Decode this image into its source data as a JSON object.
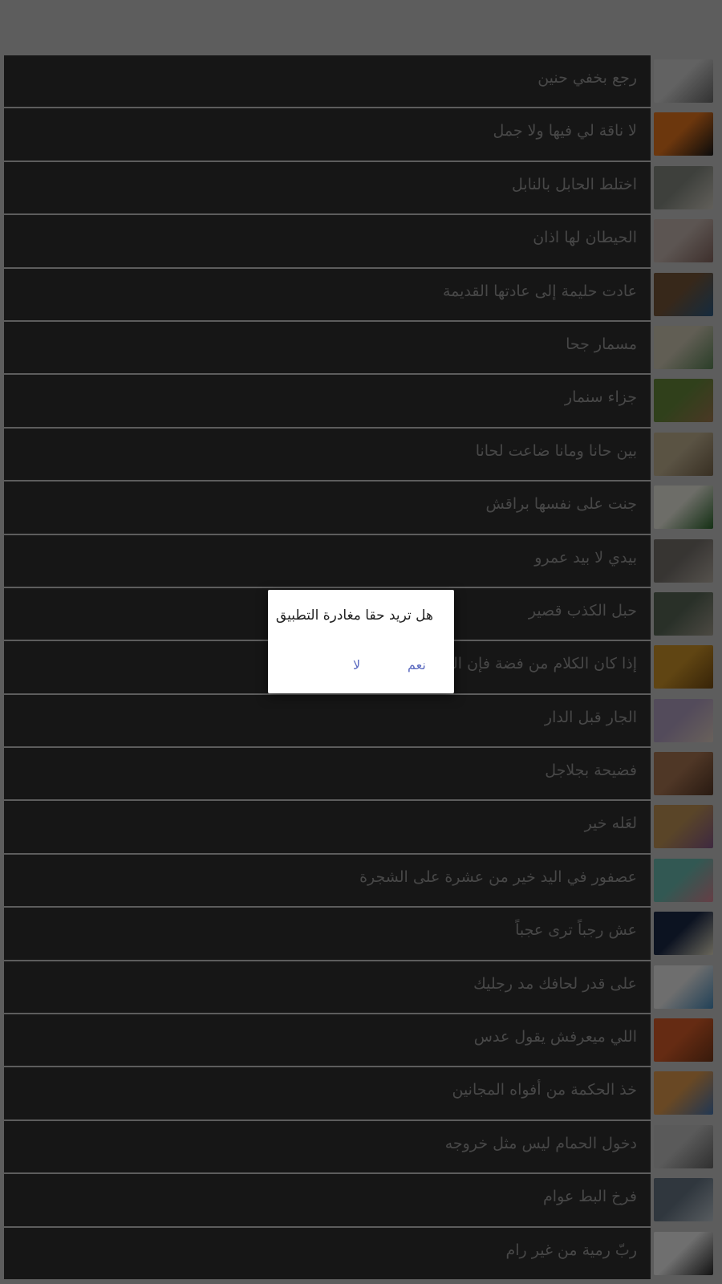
{
  "items": [
    {
      "label": "رجع بخفي حنين",
      "thumb": [
        "#d9d9d9",
        "#6f6f6f"
      ]
    },
    {
      "label": "لا ناقة لي فيها ولا جمل",
      "thumb": [
        "#f07a1e",
        "#1a1a1a"
      ]
    },
    {
      "label": "اختلط الحابل بالنابل",
      "thumb": [
        "#8a8f86",
        "#d8d3c8"
      ]
    },
    {
      "label": "الحيطان لها اذان",
      "thumb": [
        "#cdbdb6",
        "#8a6a63"
      ]
    },
    {
      "label": "عادت حليمة إلى عادتها القديمة",
      "thumb": [
        "#7b5a3b",
        "#2f5f8a"
      ]
    },
    {
      "label": "مسمار جحا",
      "thumb": [
        "#d7d0bb",
        "#5f8a5a"
      ]
    },
    {
      "label": "جزاء سنمار",
      "thumb": [
        "#6b8f3d",
        "#a67c52"
      ]
    },
    {
      "label": "بين حانا ومانا ضاعت لحانا",
      "thumb": [
        "#c8b896",
        "#7d6a4f"
      ]
    },
    {
      "label": "جنت على نفسها  براقش",
      "thumb": [
        "#f2f2e6",
        "#2e6b2e"
      ]
    },
    {
      "label": "بيدي لا بيد عمرو",
      "thumb": [
        "#7a7570",
        "#bdb5aa"
      ]
    },
    {
      "label": "حبل الكذب قصير",
      "thumb": [
        "#5b6b5a",
        "#a9a394"
      ]
    },
    {
      "label": "إذا كان الكلام من فضة فإن السكوت من ذهب",
      "thumb": [
        "#d69a2a",
        "#7a4f12"
      ]
    },
    {
      "label": "الجار قبل الدار",
      "thumb": [
        "#b9a6c9",
        "#e8d7cb"
      ]
    },
    {
      "label": "فضيحة بجلاجل",
      "thumb": [
        "#b07a55",
        "#5a3a28"
      ]
    },
    {
      "label": "لعَله خير",
      "thumb": [
        "#c79a5a",
        "#8a5b8f"
      ]
    },
    {
      "label": "عصفور في اليد خير من عشرة على الشجرة",
      "thumb": [
        "#6fc4b8",
        "#e28a9a"
      ]
    },
    {
      "label": "عش رجباً ترى عجباً",
      "thumb": [
        "#1c2a4a",
        "#e8e2c8"
      ]
    },
    {
      "label": "على قدر لحافك مد رجليك",
      "thumb": [
        "#f4f4f4",
        "#4a90c2"
      ]
    },
    {
      "label": "اللي ميعرفش يقول عدس",
      "thumb": [
        "#e0602a",
        "#7a3a1a"
      ]
    },
    {
      "label": "خذ الحكمة من أفواه المجانين",
      "thumb": [
        "#e8a050",
        "#4a7ab8"
      ]
    },
    {
      "label": "دخول الحمام ليس مثل خروجه",
      "thumb": [
        "#c8c8c8",
        "#6a6a6a"
      ]
    },
    {
      "label": "فرخ البط عوام",
      "thumb": [
        "#6a7a8a",
        "#c2ccd4"
      ]
    },
    {
      "label": "ربّ رمية من غير رام",
      "thumb": [
        "#f6f6f6",
        "#2a2a2a"
      ]
    }
  ],
  "dialog": {
    "message": "هل تريد حقا مغادرة التطبيق",
    "yes_label": "نعم",
    "no_label": "لا",
    "accent": "#5c6bc0"
  }
}
